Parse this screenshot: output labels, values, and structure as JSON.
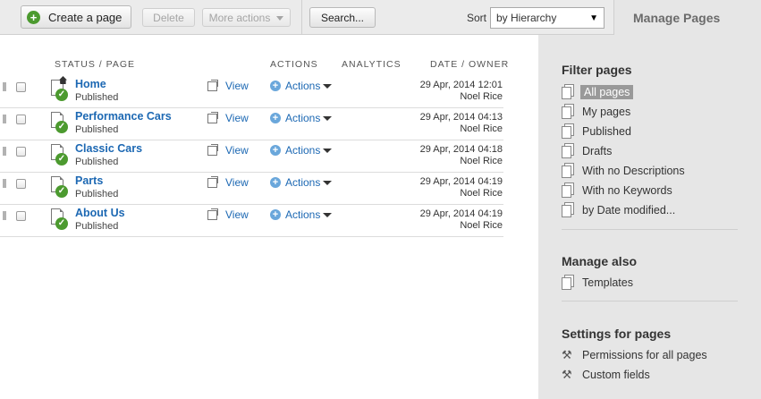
{
  "toolbar": {
    "create_label": "Create a page",
    "delete_label": "Delete",
    "more_actions_label": "More actions",
    "search_label": "Search...",
    "sort_label": "Sort",
    "sort_value": "by Hierarchy"
  },
  "table": {
    "headers": {
      "status_page": "STATUS / PAGE",
      "actions": "ACTIONS",
      "analytics": "ANALYTICS",
      "date_owner": "DATE / OWNER"
    },
    "view_label": "View",
    "actions_label": "Actions",
    "rows": [
      {
        "title": "Home",
        "status": "Published",
        "date": "29 Apr, 2014 12:01",
        "owner": "Noel Rice",
        "is_home": true
      },
      {
        "title": "Performance Cars",
        "status": "Published",
        "date": "29 Apr, 2014 04:13",
        "owner": "Noel Rice"
      },
      {
        "title": "Classic Cars",
        "status": "Published",
        "date": "29 Apr, 2014 04:18",
        "owner": "Noel Rice"
      },
      {
        "title": "Parts",
        "status": "Published",
        "date": "29 Apr, 2014 04:19",
        "owner": "Noel Rice"
      },
      {
        "title": "About Us",
        "status": "Published",
        "date": "29 Apr, 2014 04:19",
        "owner": "Noel Rice"
      }
    ]
  },
  "sidebar": {
    "header": "Manage Pages",
    "filter_title": "Filter pages",
    "filters": [
      "All pages",
      "My pages",
      "Published",
      "Drafts",
      "With no Descriptions",
      "With no Keywords",
      "by Date modified..."
    ],
    "manage_title": "Manage also",
    "manage_items": [
      "Templates"
    ],
    "settings_title": "Settings for pages",
    "settings_items": [
      "Permissions for all pages",
      "Custom fields"
    ]
  },
  "colors": {
    "accent_green": "#4c9a2f",
    "link_blue": "#1c68b3",
    "sidebar_bg": "#e6e6e6"
  }
}
